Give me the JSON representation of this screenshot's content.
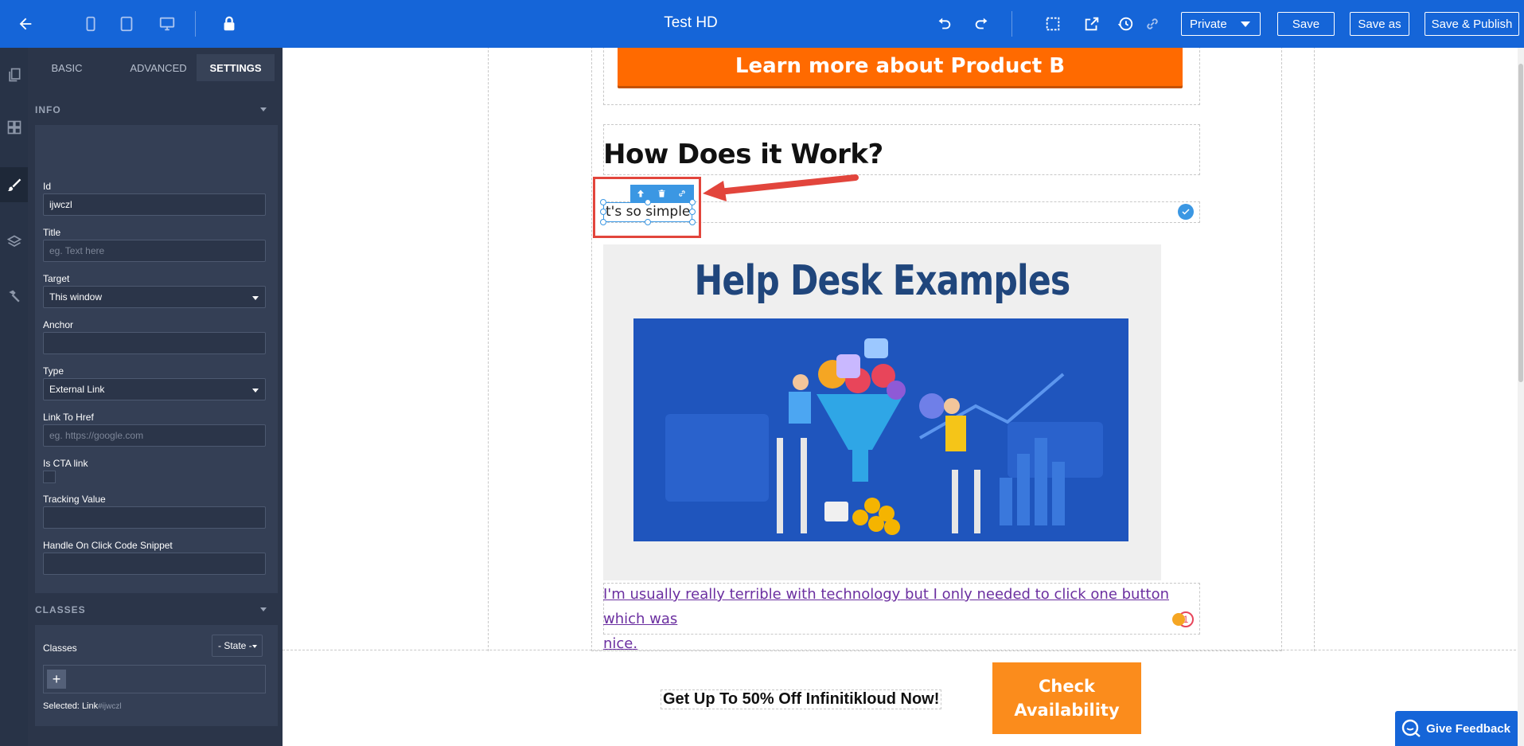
{
  "app": {
    "title": "Test HD",
    "visibility": "Private",
    "save_label": "Save",
    "save_as_label": "Save as",
    "save_publish_label": "Save & Publish",
    "brand_color": "#1565d8"
  },
  "panel": {
    "tabs": [
      "BASIC",
      "ADVANCED",
      "SETTINGS"
    ],
    "active_tab": "SETTINGS",
    "info_section": "INFO",
    "fields": {
      "id_label": "Id",
      "id_value": "ijwczl",
      "title_label": "Title",
      "title_placeholder": "eg. Text here",
      "target_label": "Target",
      "target_value": "This window",
      "anchor_label": "Anchor",
      "type_label": "Type",
      "type_value": "External Link",
      "href_label": "Link To Href",
      "href_placeholder": "eg. https://google.com",
      "cta_label": "Is CTA link",
      "tracking_label": "Tracking Value",
      "handler_label": "Handle On Click Code Snippet"
    },
    "classes_section": "CLASSES",
    "classes_label": "Classes",
    "state_value": "- State -",
    "add_symbol": "+",
    "selected_prefix": "Selected:",
    "selected_type": "Link",
    "selected_id": "#ijwczl"
  },
  "canvas": {
    "learn_more": "Learn more about Product B",
    "heading": "How Does it Work?",
    "simple_text": "t's so simple",
    "image_title": "Help Desk Examples",
    "testimonial_line1_a": "I'm usually really terrible with ",
    "testimonial_line1_b": "technology",
    "testimonial_line1_c": " but I only needed to click one button which was",
    "testimonial_line2": "nice.",
    "cta_text": "Get Up To 50% Off Infinitikloud Now!",
    "cta_button": "Check Availability",
    "feedback": "Give Feedback",
    "grammar_count": "1",
    "accent_orange": "#ff6a00",
    "cta_orange": "#fb8c1c"
  },
  "icons": {
    "back": "arrow-left-icon",
    "mobile": "mobile-icon",
    "tablet": "tablet-icon",
    "desktop": "desktop-icon",
    "lock": "lock-icon",
    "undo": "undo-icon",
    "redo": "redo-icon",
    "select": "dashed-square-icon",
    "preview": "open-external-icon",
    "history": "history-icon",
    "link": "link-icon"
  }
}
